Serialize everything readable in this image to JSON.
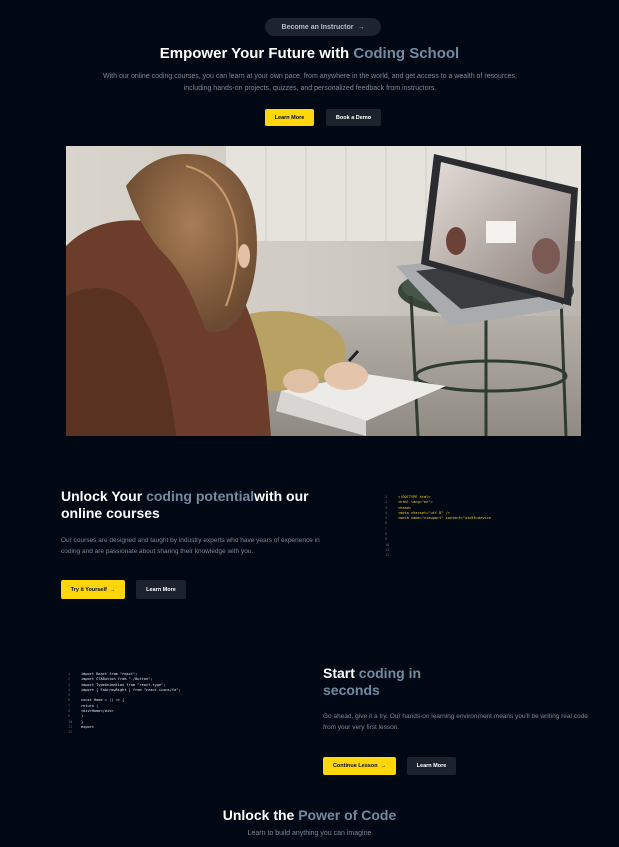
{
  "hero": {
    "badge_label": "Become an Instructor",
    "badge_icon": "arrow-right-icon",
    "title_plain": "Empower Your Future with ",
    "title_highlight": "Coding School",
    "subtitle": "With our online coding courses, you can learn at your own pace, from anywhere in the world, and get access to a wealth of resources, including hands-on projects, quizzes, and personalized feedback from instructors.",
    "primary_button": "Learn More",
    "secondary_button": "Book a Demo"
  },
  "section_courses": {
    "title_plain_1": "Unlock Your ",
    "title_highlight": "coding potential",
    "title_plain_2": "with our online courses",
    "text": "Our courses are designed and taught by industry experts who have years of experience in coding and are passionate about sharing their knowledge with you.",
    "primary_button": "Try it Yourself",
    "secondary_button": "Learn More",
    "code_numbers": [
      "1",
      "2",
      "3",
      "4",
      "5",
      "6",
      "7",
      "8",
      "9",
      "10",
      "11",
      "12"
    ],
    "code_lines": [
      "<!DOCTYPE html>",
      "<html lang=\"en\">",
      "<head>",
      "<meta charset=\"utf-8\" />",
      "<meta name=\"viewport\" content=\"width=device",
      "",
      "",
      "",
      "",
      "",
      "",
      ""
    ]
  },
  "section_start": {
    "title_plain": "Start ",
    "title_highlight_1": "coding in",
    "title_highlight_2": "seconds",
    "text": "Go ahead, give it a try. Our hands-on learning environment means you'll be writing real code from your very first lesson.",
    "primary_button": "Continue Lesson",
    "secondary_button": "Learn More",
    "code_numbers": [
      "1",
      "2",
      "3",
      "4",
      "5",
      "6",
      "7",
      "8",
      "9",
      "10",
      "11",
      "12"
    ],
    "code_lines": [
      "import React from \"react\";",
      "import CTAButton from \"./Button\";",
      "import TypeAnimation from \"react-type\";",
      "import { FaArrowRight } from \"react-icons/fa\";",
      "",
      "const Home = () => {",
      "return (",
      "<div>Home</div>",
      ")",
      "}",
      "export",
      ""
    ]
  },
  "section_power": {
    "title_plain": "Unlock the ",
    "title_highlight": "Power of Code",
    "subtitle": "Learn to build anything you can imagine"
  },
  "colors": {
    "background": "#000814",
    "accent_yellow": "#ffd60a",
    "highlight_blue": "#718ca0",
    "button_dark": "#1c232d"
  }
}
